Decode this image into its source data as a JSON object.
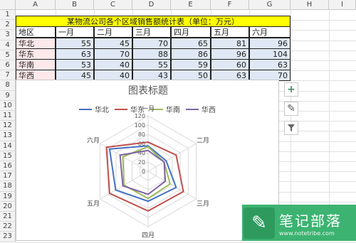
{
  "column_headers": [
    "A",
    "B",
    "C",
    "D",
    "E",
    "F",
    "G",
    "H",
    "I"
  ],
  "row_headers": [
    "1",
    "2",
    "3",
    "4",
    "5",
    "6",
    "7",
    "8",
    "9",
    "10",
    "11",
    "12",
    "13",
    "14",
    "15",
    "16",
    "17",
    "18",
    "19",
    "20",
    "21",
    "22",
    "23"
  ],
  "table": {
    "title": "某物流公司各个区域销售额统计表（单位：万元）",
    "corner_label": "地区",
    "months": [
      "一月",
      "二月",
      "三月",
      "四月",
      "五月",
      "六月"
    ],
    "rows": [
      {
        "region": "华北",
        "values": [
          "55",
          "45",
          "70",
          "65",
          "81",
          "96"
        ]
      },
      {
        "region": "华东",
        "values": [
          "63",
          "70",
          "88",
          "86",
          "96",
          "104"
        ]
      },
      {
        "region": "华南",
        "values": [
          "53",
          "40",
          "55",
          "59",
          "60",
          "63"
        ]
      },
      {
        "region": "华西",
        "values": [
          "45",
          "40",
          "43",
          "50",
          "63",
          "70"
        ]
      }
    ]
  },
  "chart_data": {
    "type": "radar",
    "title": "图表标题",
    "categories": [
      "一月",
      "二月",
      "三月",
      "四月",
      "五月",
      "六月"
    ],
    "series": [
      {
        "name": "华北",
        "color": "#4472c4",
        "values": [
          55,
          45,
          70,
          65,
          81,
          96
        ]
      },
      {
        "name": "华东",
        "color": "#c0504d",
        "values": [
          63,
          70,
          88,
          86,
          96,
          104
        ]
      },
      {
        "name": "华南",
        "color": "#9bbb59",
        "values": [
          53,
          40,
          55,
          59,
          60,
          63
        ]
      },
      {
        "name": "华西",
        "color": "#8064a2",
        "values": [
          45,
          40,
          43,
          50,
          63,
          70
        ]
      }
    ],
    "rlim": [
      0,
      120
    ],
    "ticks": [
      "0",
      "20",
      "40",
      "60",
      "80",
      "100",
      "120"
    ],
    "legend_position": "top"
  },
  "chart_tools": {
    "add_icon": "plus-icon",
    "style_icon": "brush-icon",
    "filter_icon": "funnel-icon"
  },
  "watermark": {
    "title": "笔记部落",
    "url": "www.notetribe.com"
  }
}
